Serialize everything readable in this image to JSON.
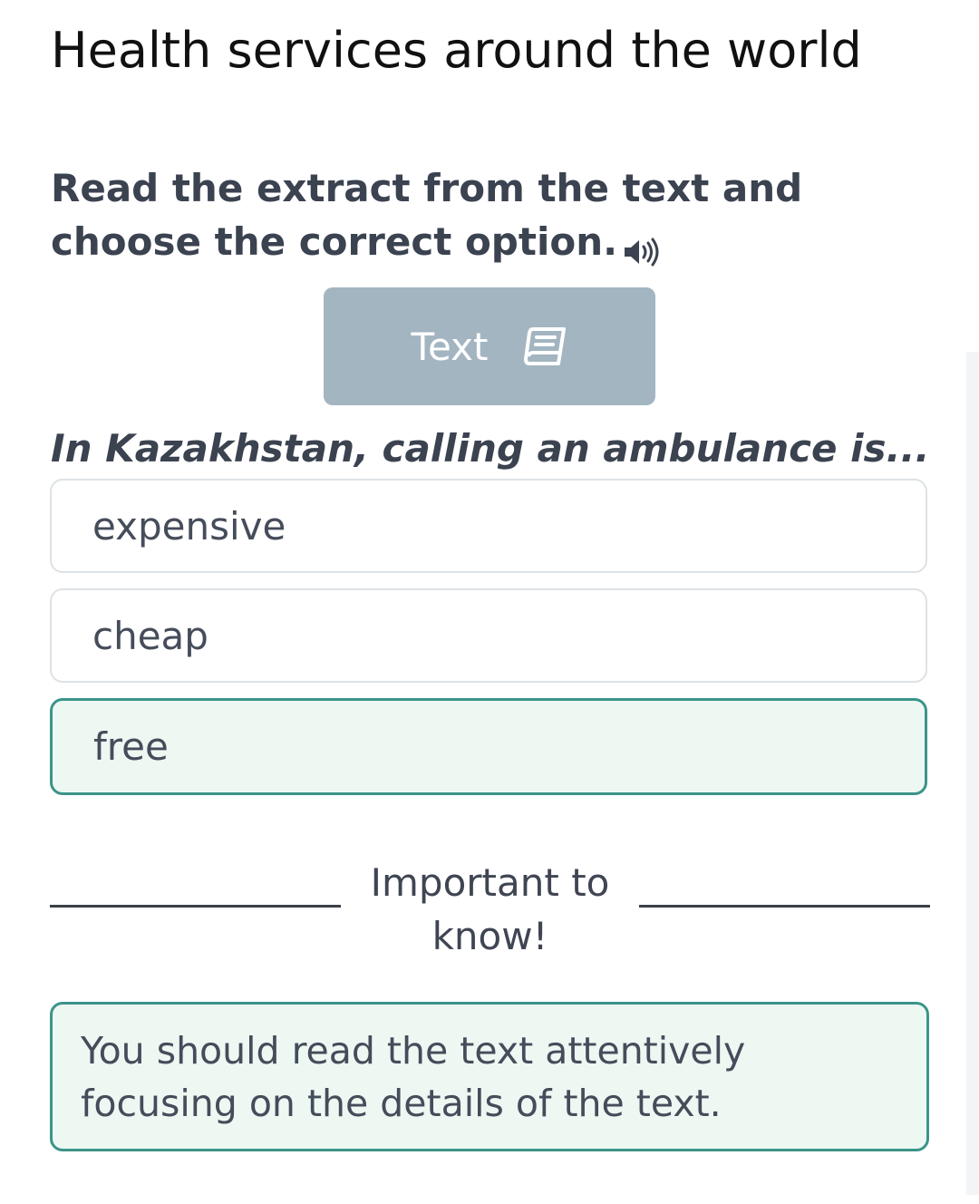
{
  "page": {
    "title": "Health services around the world"
  },
  "task": {
    "instruction": "Read the extract from the text and choose the correct option.",
    "audio_icon": "speaker-icon"
  },
  "text_button": {
    "label": "Text",
    "icon": "book-icon"
  },
  "question": {
    "prompt": "In Kazakhstan, calling an ambulance is...",
    "options": [
      {
        "label": "expensive",
        "selected": false
      },
      {
        "label": "cheap",
        "selected": false
      },
      {
        "label": "free",
        "selected": true
      }
    ]
  },
  "important": {
    "heading": "Important to know!",
    "note": "You should read the text attentively focusing on the details of the text."
  },
  "colors": {
    "accent": "#3c9489",
    "selected_bg": "#edf8f3",
    "button_bg": "#a3b5c1",
    "text_dark": "#3b4250"
  }
}
